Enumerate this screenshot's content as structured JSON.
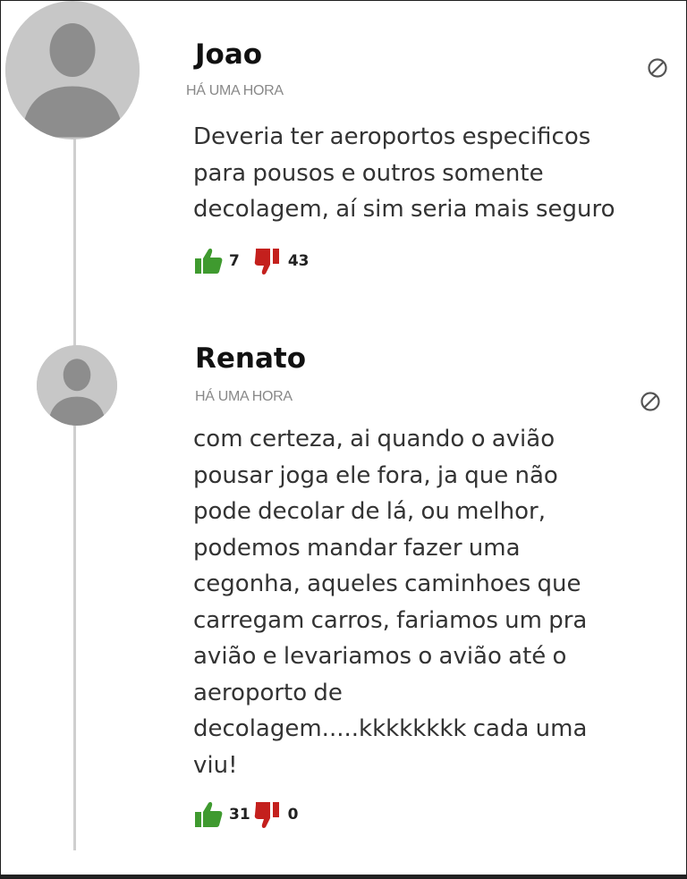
{
  "colors": {
    "like_green": "#3f9a2f",
    "dislike_red": "#c4201d",
    "avatar_bg": "#c7c7c7",
    "avatar_fg": "#8d8d8d",
    "thread_line": "#cfcfcf",
    "meta_gray": "#888888"
  },
  "icons": {
    "report": "block-icon",
    "like": "thumbs-up-icon",
    "dislike": "thumbs-down-icon"
  },
  "comments": [
    {
      "author": "Joao",
      "time": "HÁ UMA HORA",
      "text": "Deveria ter aeroportos especificos\npara pousos e outros somente\ndecolagem, aí sim seria mais seguro",
      "likes": "7",
      "dislikes": "43"
    },
    {
      "author": "Renato",
      "time": "HÁ UMA HORA",
      "text": "com certeza, ai quando o avião\npousar joga ele fora, ja que não\npode decolar de lá, ou melhor,\npodemos mandar fazer uma\ncegonha, aqueles caminhoes que\ncarregam carros, fariamos um pra\navião e levariamos o avião até o\naeroporto de\ndecolagem.....kkkkkkkk cada uma\nviu!",
      "likes": "31",
      "dislikes": "0"
    }
  ]
}
